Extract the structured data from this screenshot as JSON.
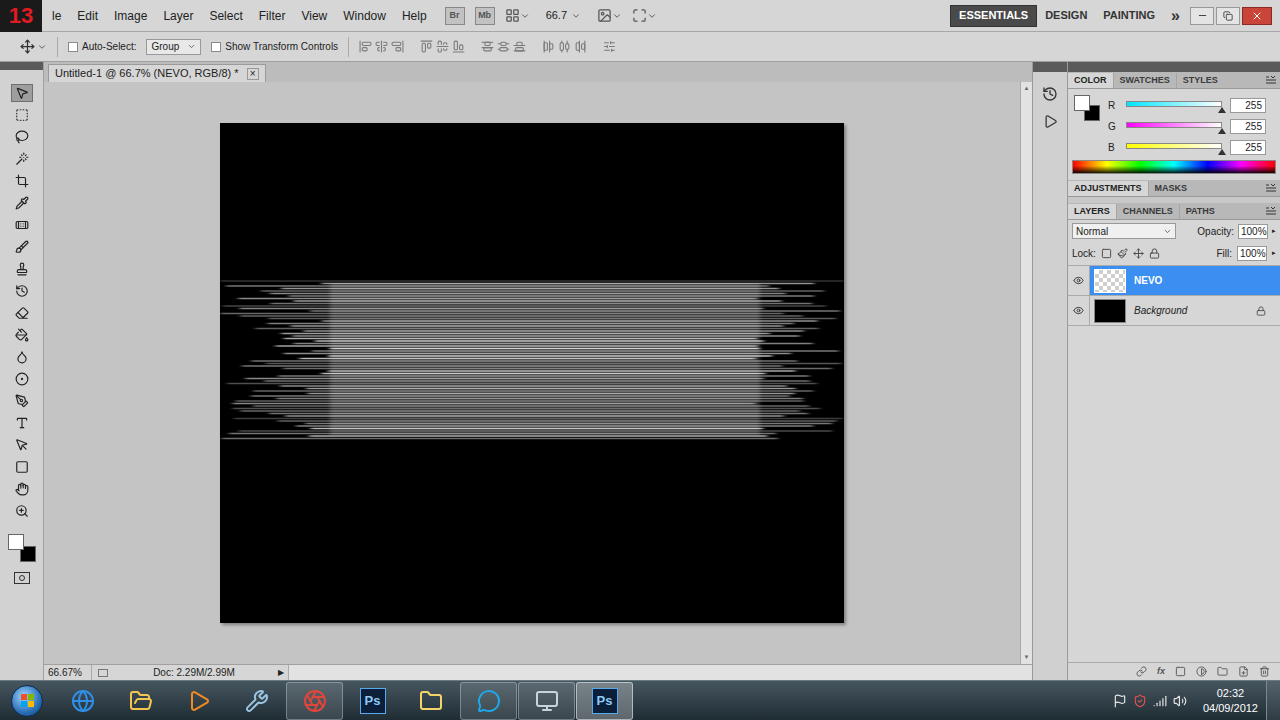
{
  "app_bar": {
    "logo": "13",
    "menus": [
      "le",
      "Edit",
      "Image",
      "Layer",
      "Select",
      "Filter",
      "View",
      "Window",
      "Help"
    ],
    "bridge": "Br",
    "mini_bridge": "Mb",
    "zoom": "66.7",
    "workspaces": [
      {
        "label": "ESSENTIALS",
        "selected": true
      },
      {
        "label": "DESIGN",
        "selected": false
      },
      {
        "label": "PAINTING",
        "selected": false
      }
    ],
    "more": "»"
  },
  "options_bar": {
    "auto_select": {
      "label": "Auto-Select:",
      "checked": false
    },
    "target": "Group",
    "transform_controls": {
      "label": "Show Transform Controls",
      "checked": false
    }
  },
  "toolbar": {
    "tools": [
      {
        "kind": "move",
        "selected": true
      },
      {
        "kind": "marquee",
        "selected": false
      },
      {
        "kind": "lasso",
        "selected": false
      },
      {
        "kind": "wand",
        "selected": false
      },
      {
        "kind": "crop",
        "selected": false
      },
      {
        "kind": "eyedropper",
        "selected": false
      },
      {
        "kind": "healing",
        "selected": false
      },
      {
        "kind": "brush",
        "selected": false
      },
      {
        "kind": "stamp",
        "selected": false
      },
      {
        "kind": "history",
        "selected": false
      },
      {
        "kind": "eraser",
        "selected": false
      },
      {
        "kind": "bucket",
        "selected": false
      },
      {
        "kind": "blur",
        "selected": false
      },
      {
        "kind": "dodge",
        "selected": false
      },
      {
        "kind": "pen",
        "selected": false
      },
      {
        "kind": "type",
        "selected": false
      },
      {
        "kind": "path",
        "selected": false
      },
      {
        "kind": "shape",
        "selected": false
      },
      {
        "kind": "hand",
        "selected": false
      },
      {
        "kind": "zoom",
        "selected": false
      }
    ]
  },
  "document": {
    "tab": "Untitled-1 @ 66.7% (NEVO, RGB/8) *",
    "close": "×"
  },
  "status_bar": {
    "zoom": "66.67%",
    "doc": "Doc: 2.29M/2.99M",
    "arrow": "▶"
  },
  "color_panel": {
    "tabs": [
      {
        "label": "COLOR",
        "selected": true
      },
      {
        "label": "SWATCHES",
        "selected": false
      },
      {
        "label": "STYLES",
        "selected": false
      }
    ],
    "channels": [
      {
        "name": "R",
        "value": "255",
        "level": 1,
        "color": "#00e5ff"
      },
      {
        "name": "G",
        "value": "255",
        "level": 1,
        "color": "#ff00ff"
      },
      {
        "name": "B",
        "value": "255",
        "level": 1,
        "color": "#ffff00"
      }
    ]
  },
  "adjustments_panel": {
    "tabs": [
      {
        "label": "ADJUSTMENTS",
        "selected": true
      },
      {
        "label": "MASKS",
        "selected": false
      }
    ]
  },
  "layers_panel": {
    "tabs": [
      {
        "label": "LAYERS",
        "selected": true
      },
      {
        "label": "CHANNELS",
        "selected": false
      },
      {
        "label": "PATHS",
        "selected": false
      }
    ],
    "blend_mode": "Normal",
    "opacity_label": "Opacity:",
    "opacity": "100%",
    "lock_label": "Lock:",
    "fill_label": "Fill:",
    "fill": "100%",
    "layers": [
      {
        "name": "NEVO",
        "selected": true,
        "visible": true,
        "locked": false,
        "kind": "transparent"
      },
      {
        "name": "Background",
        "selected": false,
        "visible": true,
        "locked": true,
        "kind": "fill"
      }
    ]
  },
  "taskbar": {
    "items": [
      {
        "kind": "browser",
        "open": false,
        "active": false
      },
      {
        "kind": "folder",
        "open": false,
        "active": false
      },
      {
        "kind": "media",
        "open": false,
        "active": false
      },
      {
        "kind": "tool",
        "open": false,
        "active": false
      },
      {
        "kind": "chrome",
        "open": true,
        "active": false
      },
      {
        "kind": "photoshop",
        "label": "Ps",
        "open": false,
        "active": false
      },
      {
        "kind": "explorer",
        "open": false,
        "active": false
      },
      {
        "kind": "skype",
        "open": true,
        "active": false
      },
      {
        "kind": "monitor",
        "open": true,
        "active": false
      },
      {
        "kind": "photoshop",
        "label": "Ps",
        "open": true,
        "active": true
      }
    ],
    "clock": {
      "time": "02:32",
      "date": "04/09/2012"
    }
  }
}
